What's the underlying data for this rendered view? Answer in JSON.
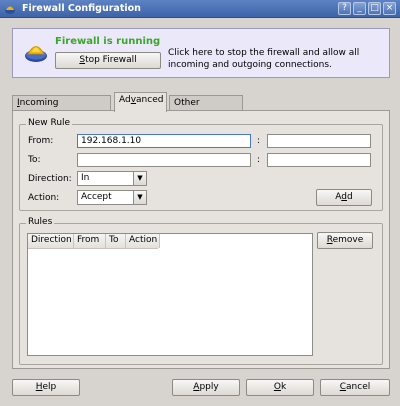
{
  "window": {
    "title": "Firewall Configuration",
    "controls": [
      "?",
      "_",
      "□",
      "×"
    ]
  },
  "banner": {
    "status": "Firewall is running",
    "button": {
      "label_prefix": "",
      "label_mnemonic": "S",
      "label_rest": "top Firewall"
    },
    "description": "Click here to stop the firewall and allow all incoming and outgoing connections."
  },
  "tabs": [
    {
      "pre": "",
      "mn": "I",
      "post": "ncoming Connections",
      "active": false
    },
    {
      "pre": "Ad",
      "mn": "v",
      "post": "anced",
      "active": true
    },
    {
      "pre": "Other Feat",
      "mn": "u",
      "post": "res",
      "active": false
    }
  ],
  "new_rule": {
    "group_title": "New Rule",
    "from_label": "From:",
    "from_value": "192.168.1.10",
    "from_port_value": "",
    "to_label": "To:",
    "to_value": "",
    "to_port_value": "",
    "port_separator": ":",
    "direction_label": "Direction:",
    "direction_value": "In",
    "action_label": "Action:",
    "action_value": "Accept",
    "add_button": {
      "pre": "A",
      "mn": "d",
      "post": "d"
    }
  },
  "rules": {
    "group_title": "Rules",
    "columns": [
      "Direction",
      "From",
      "To",
      "Action"
    ],
    "remove_button": {
      "pre": "",
      "mn": "R",
      "post": "emove"
    }
  },
  "footer": {
    "help": {
      "pre": "",
      "mn": "H",
      "post": "elp"
    },
    "apply": {
      "pre": "",
      "mn": "A",
      "post": "pply"
    },
    "ok": {
      "pre": "",
      "mn": "O",
      "post": "k"
    },
    "cancel": {
      "pre": "",
      "mn": "C",
      "post": "ancel"
    }
  },
  "colors": {
    "status_green": "#3aa62a",
    "titlebar_blue": "#4a70b4",
    "banner_bg": "#ebe8f9"
  }
}
